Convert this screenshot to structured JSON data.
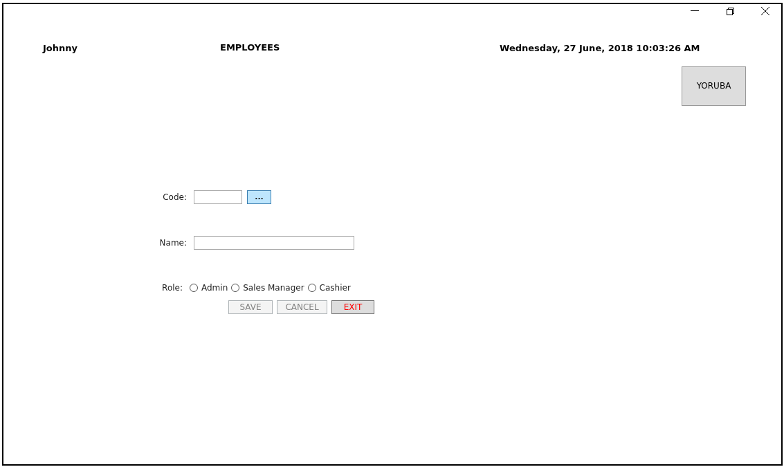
{
  "header": {
    "user": "Johnny",
    "title": "EMPLOYEES",
    "datetime": "Wednesday, 27 June, 2018 10:03:26 AM"
  },
  "language_button": "YORUBA",
  "form": {
    "code_label": "Code:",
    "browse_button": "...",
    "name_label": "Name:",
    "role_label": "Role:",
    "roles": [
      {
        "label": "Admin",
        "selected": false
      },
      {
        "label": "Sales Manager",
        "selected": false
      },
      {
        "label": "Cashier",
        "selected": false
      }
    ]
  },
  "buttons": [
    {
      "label": "SAVE",
      "kind": "save",
      "disabled": true
    },
    {
      "label": "CANCEL",
      "kind": "cancel",
      "disabled": true
    },
    {
      "label": "EXIT",
      "kind": "exit",
      "disabled": false
    }
  ]
}
